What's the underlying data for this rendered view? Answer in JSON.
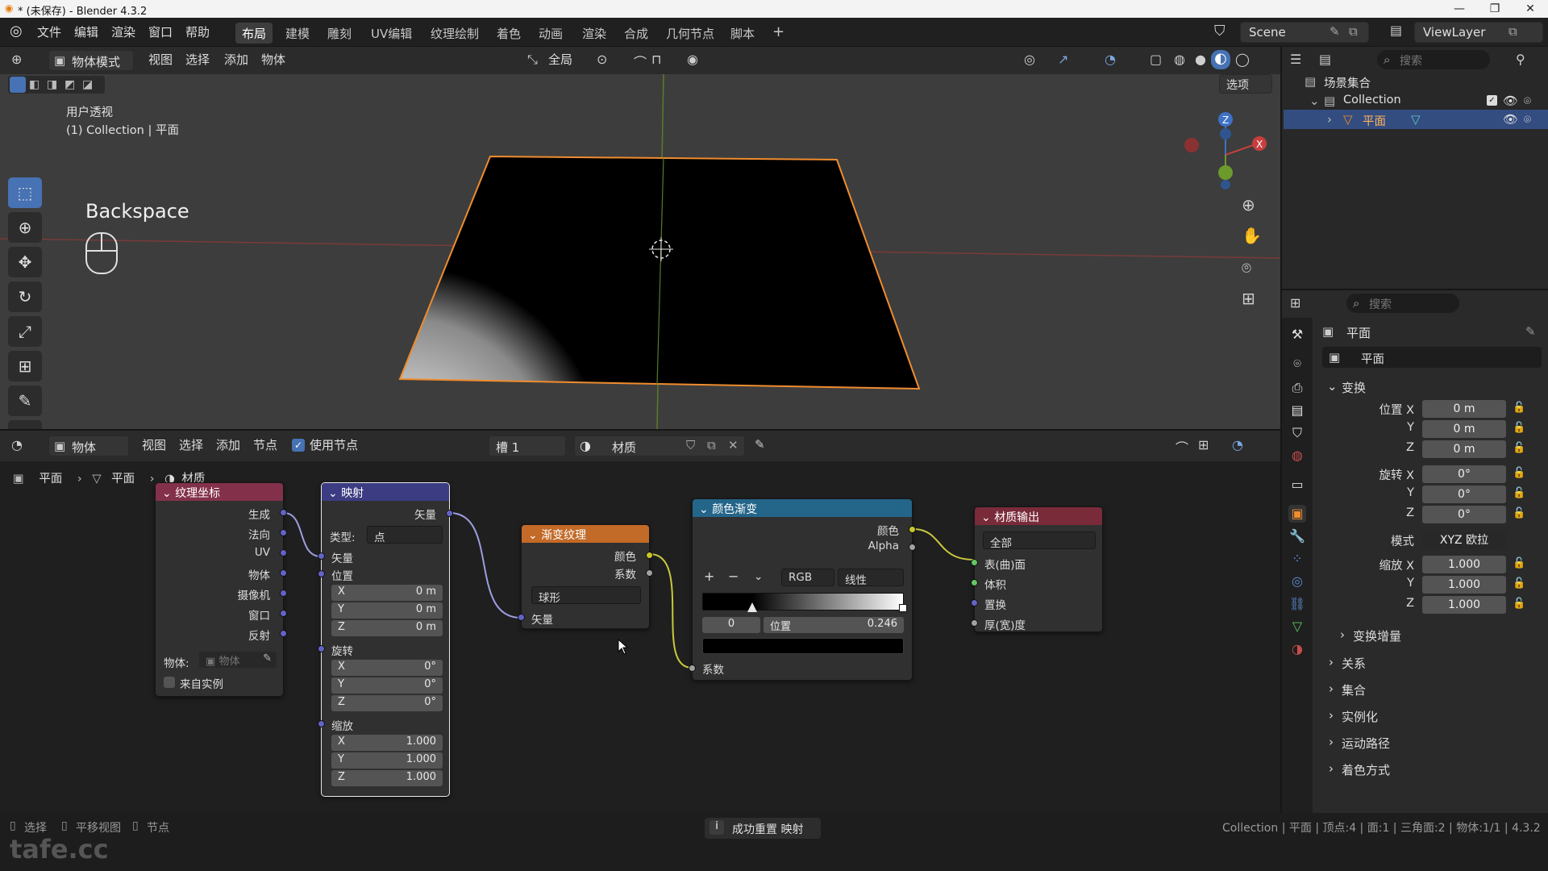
{
  "window": {
    "title": "* (未保存) - Blender 4.3.2",
    "min": "—",
    "max": "❐",
    "close": "✕"
  },
  "menu": [
    "文件",
    "编辑",
    "渲染",
    "窗口",
    "帮助"
  ],
  "workspaces": [
    "布局",
    "建模",
    "雕刻",
    "UV编辑",
    "纹理绘制",
    "着色",
    "动画",
    "渲染",
    "合成",
    "几何节点",
    "脚本"
  ],
  "active_workspace": "布局",
  "add_ws": "+",
  "scene": {
    "label": "Scene",
    "viewlayer": "ViewLayer"
  },
  "viewport": {
    "mode": "物体模式",
    "menus": [
      "视图",
      "选择",
      "添加",
      "物体"
    ],
    "orientation": "全局",
    "options": "选项",
    "view_name": "用户透视",
    "collection_line": "(1) Collection | 平面",
    "key_overlay": "Backspace"
  },
  "node_editor": {
    "type": "物体",
    "menus": [
      "视图",
      "选择",
      "添加",
      "节点"
    ],
    "use_nodes": "使用节点",
    "slot": "槽 1",
    "material": "材质",
    "breadcrumb": [
      "平面",
      "平面",
      "材质"
    ]
  },
  "nodes": {
    "texcoord": {
      "title": "纹理坐标",
      "outputs": [
        "生成",
        "法向",
        "UV",
        "物体",
        "摄像机",
        "窗口",
        "反射"
      ],
      "object_label": "物体:",
      "object_placeholder": "物体",
      "from_instancer": "来自实例"
    },
    "mapping": {
      "title": "映射",
      "output": "矢量",
      "type_label": "类型:",
      "type_value": "点",
      "vector": "矢量",
      "location": "位置",
      "loc": [
        "0 m",
        "0 m",
        "0 m"
      ],
      "rotation": "旋转",
      "rot": [
        "0°",
        "0°",
        "0°"
      ],
      "scale": "缩放",
      "scl": [
        "1.000",
        "1.000",
        "1.000"
      ],
      "axes": [
        "X",
        "Y",
        "Z"
      ]
    },
    "gradient": {
      "title": "渐变纹理",
      "out_color": "颜色",
      "out_fac": "系数",
      "type": "球形",
      "in_vector": "矢量"
    },
    "colorramp": {
      "title": "颜色渐变",
      "out_color": "颜色",
      "out_alpha": "Alpha",
      "mode": "RGB",
      "interp": "线性",
      "stop_index": "0",
      "pos_label": "位置",
      "pos_value": "0.246",
      "in_fac": "系数",
      "add": "+",
      "remove": "−"
    },
    "output": {
      "title": "材质输出",
      "target": "全部",
      "inputs": [
        "表(曲)面",
        "体积",
        "置换",
        "厚(宽)度"
      ]
    }
  },
  "outliner": {
    "search": "搜索",
    "scene_collection": "场景集合",
    "collection": "Collection",
    "object": "平面"
  },
  "properties": {
    "search": "搜索",
    "object_name": "平面",
    "data_name": "平面",
    "transform": "变换",
    "location": {
      "label": "位置",
      "values": [
        "0 m",
        "0 m",
        "0 m"
      ]
    },
    "rotation": {
      "label": "旋转",
      "values": [
        "0°",
        "0°",
        "0°"
      ]
    },
    "mode_label": "模式",
    "mode_value": "XYZ 欧拉",
    "scale": {
      "label": "缩放",
      "values": [
        "1.000",
        "1.000",
        "1.000"
      ]
    },
    "axes": [
      "X",
      "Y",
      "Z"
    ],
    "delta": "变换增量",
    "sections": [
      "关系",
      "集合",
      "实例化",
      "运动路径",
      "着色方式"
    ]
  },
  "status": {
    "select": "选择",
    "pan": "平移视图",
    "node": "节点",
    "message": "成功重置 映射",
    "stats": "Collection | 平面 | 顶点:4 | 面:1 | 三角面:2 | 物体:1/1 | 4.3.2"
  },
  "watermark": "tafe.cc"
}
